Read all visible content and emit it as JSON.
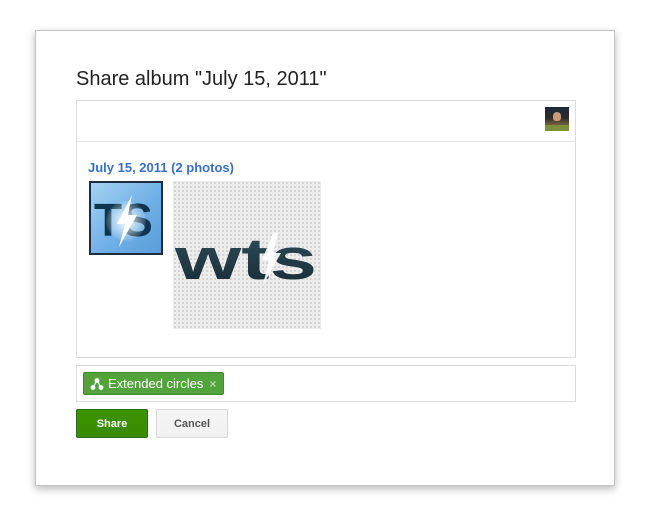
{
  "dialog": {
    "title": "Share album \"July 15, 2011\""
  },
  "post": {
    "album_link": "July 15, 2011 (2 photos)",
    "photos": [
      {
        "icon": "ts-logo-photo",
        "text": "TS"
      },
      {
        "icon": "wts-logo-photo",
        "text": "wts"
      }
    ]
  },
  "audience": {
    "chip_label": "Extended circles",
    "chip_remove": "×"
  },
  "actions": {
    "share_label": "Share",
    "cancel_label": "Cancel"
  },
  "colors": {
    "accent_green": "#3d9400",
    "chip_green": "#53a33c",
    "link_blue": "#3b6fc2"
  }
}
